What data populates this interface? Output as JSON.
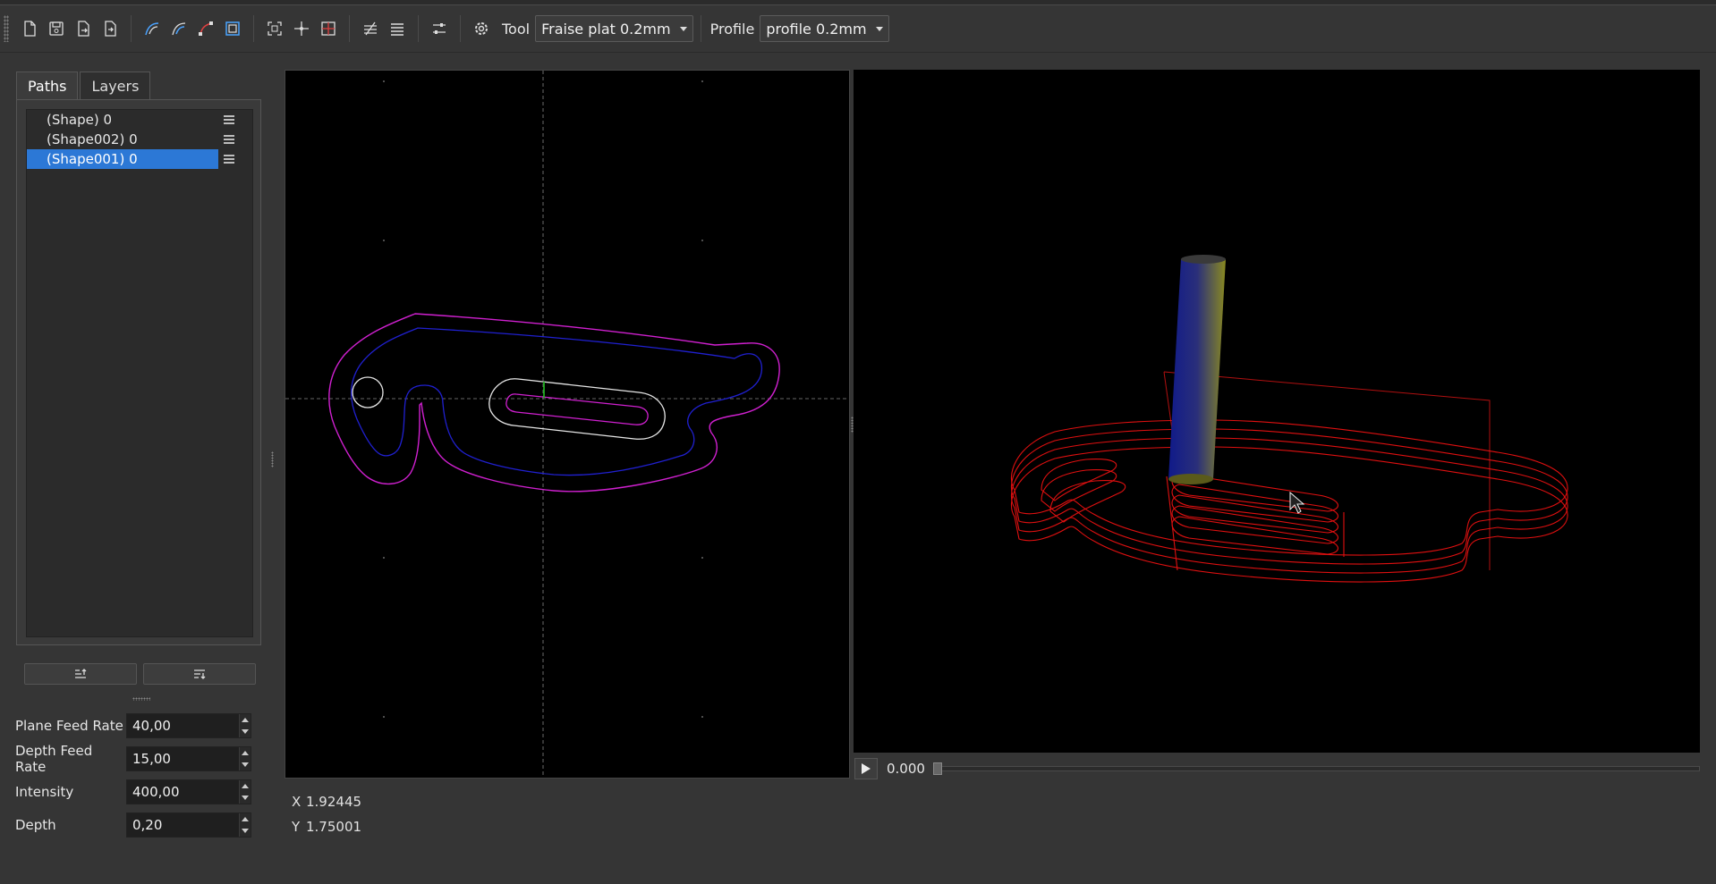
{
  "toolbar": {
    "tool_label": "Tool",
    "tool_value": "Fraise plat 0.2mm",
    "profile_label": "Profile",
    "profile_value": "profile 0.2mm"
  },
  "tabs": [
    {
      "label": "Paths",
      "active": true
    },
    {
      "label": "Layers",
      "active": false
    }
  ],
  "paths": [
    {
      "label": "(Shape) 0",
      "selected": false
    },
    {
      "label": "(Shape002) 0",
      "selected": false
    },
    {
      "label": "(Shape001) 0",
      "selected": true
    }
  ],
  "params": [
    {
      "label": "Plane Feed Rate",
      "value": "40,00"
    },
    {
      "label": "Depth Feed Rate",
      "value": "15,00"
    },
    {
      "label": "Intensity",
      "value": "400,00"
    },
    {
      "label": "Depth",
      "value": "0,20"
    }
  ],
  "cursor": {
    "x_label": "X",
    "x_value": "1.92445",
    "y_label": "Y",
    "y_value": "1.75001"
  },
  "simulation": {
    "time": "0.000",
    "progress": 0
  },
  "colors": {
    "selection": "#2c78d6",
    "outer_contour": "#d020d0",
    "inner_contour": "#2020d0",
    "path_3d": "#e01010",
    "tool_cylinder": "#1e2a9a"
  }
}
